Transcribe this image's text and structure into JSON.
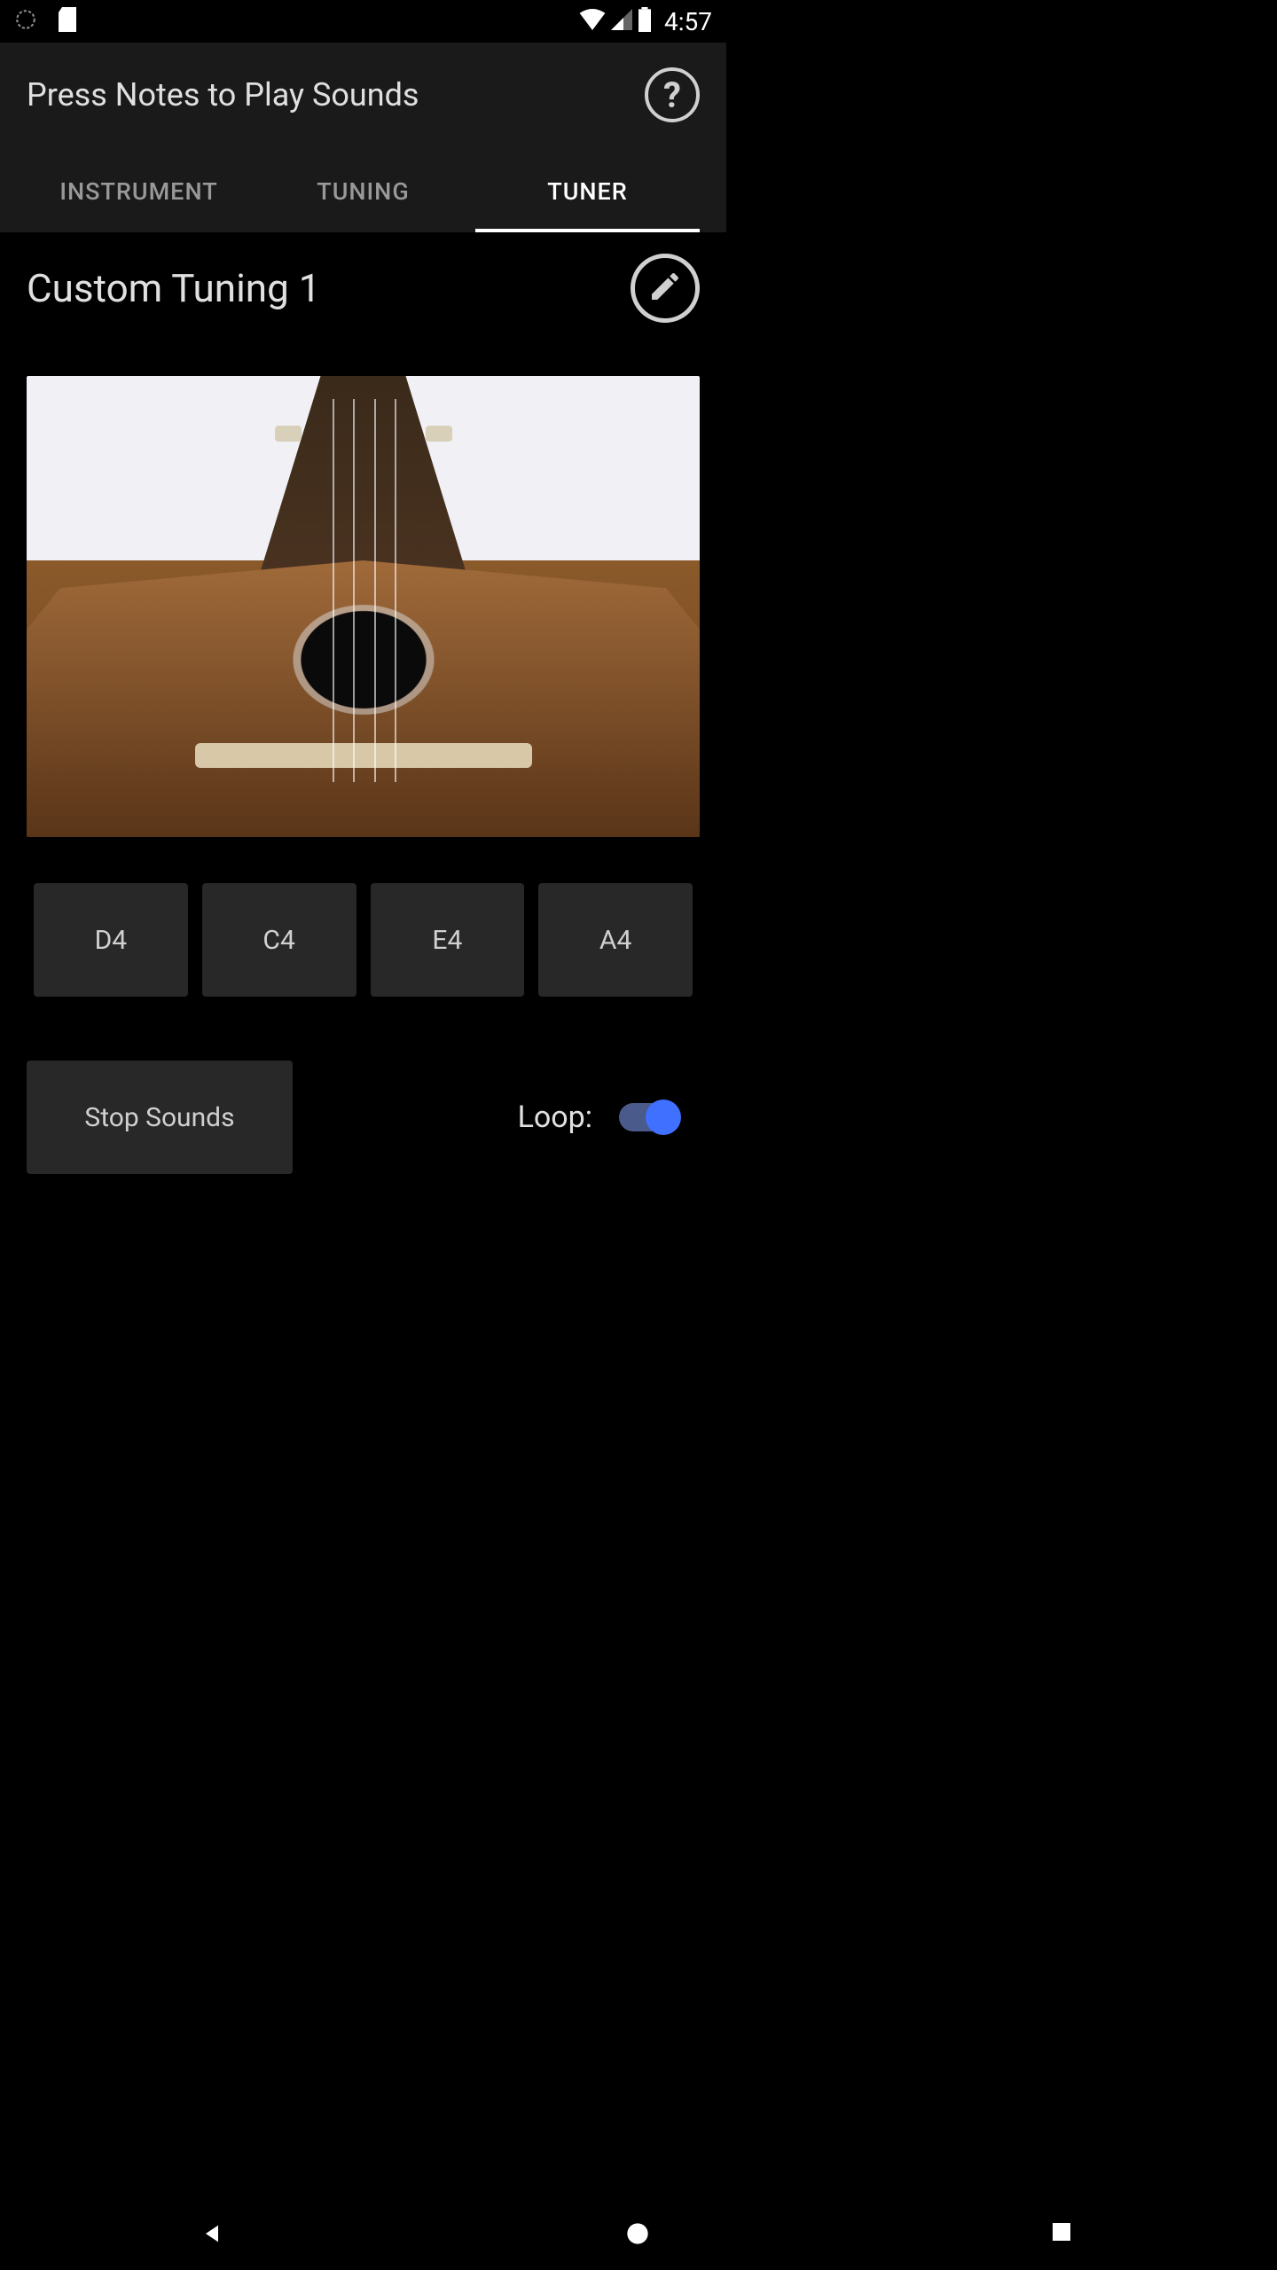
{
  "statusBar": {
    "time": "4:57"
  },
  "header": {
    "title": "Press Notes to Play Sounds"
  },
  "tabs": {
    "items": [
      {
        "label": "INSTRUMENT",
        "active": false
      },
      {
        "label": "TUNING",
        "active": false
      },
      {
        "label": "TUNER",
        "active": true
      }
    ]
  },
  "tuning": {
    "name": "Custom Tuning 1"
  },
  "notes": [
    {
      "label": "D4"
    },
    {
      "label": "C4"
    },
    {
      "label": "E4"
    },
    {
      "label": "A4"
    }
  ],
  "controls": {
    "stopLabel": "Stop Sounds",
    "loopLabel": "Loop:",
    "loopEnabled": true
  }
}
